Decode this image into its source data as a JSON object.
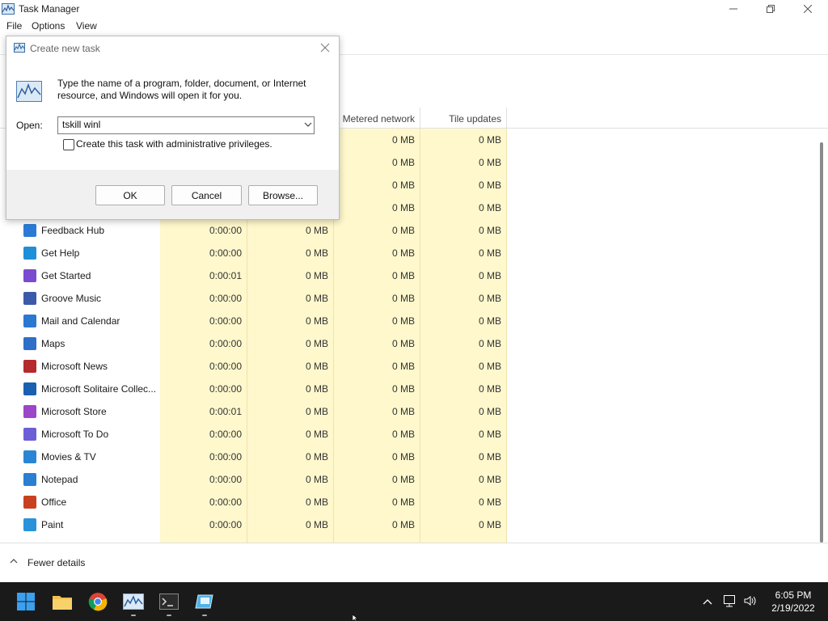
{
  "window": {
    "title": "Task Manager",
    "menu": [
      "File",
      "Options",
      "View"
    ],
    "fewer_details": "Fewer details"
  },
  "columns": {
    "metered": "Metered network",
    "tile": "Tile updates"
  },
  "rows": [
    {
      "name": "",
      "c1": "",
      "c2": "",
      "c3": "0 MB",
      "c4": "0 MB",
      "color": "#ffffff"
    },
    {
      "name": "",
      "c1": "",
      "c2": "",
      "c3": "0 MB",
      "c4": "0 MB",
      "color": "#ffffff"
    },
    {
      "name": "",
      "c1": "",
      "c2": "",
      "c3": "0 MB",
      "c4": "0 MB",
      "color": "#ffffff"
    },
    {
      "name": "",
      "c1": "",
      "c2": "",
      "c3": "0 MB",
      "c4": "0 MB",
      "color": "#ffffff"
    },
    {
      "name": "Feedback Hub",
      "c1": "0:00:00",
      "c2": "0 MB",
      "c3": "0 MB",
      "c4": "0 MB",
      "color": "#2b7bd6"
    },
    {
      "name": "Get Help",
      "c1": "0:00:00",
      "c2": "0 MB",
      "c3": "0 MB",
      "c4": "0 MB",
      "color": "#1f8fd8"
    },
    {
      "name": "Get Started",
      "c1": "0:00:01",
      "c2": "0 MB",
      "c3": "0 MB",
      "c4": "0 MB",
      "color": "#7a4bd0"
    },
    {
      "name": "Groove Music",
      "c1": "0:00:00",
      "c2": "0 MB",
      "c3": "0 MB",
      "c4": "0 MB",
      "color": "#3b5aa8"
    },
    {
      "name": "Mail and Calendar",
      "c1": "0:00:00",
      "c2": "0 MB",
      "c3": "0 MB",
      "c4": "0 MB",
      "color": "#2a78d0"
    },
    {
      "name": "Maps",
      "c1": "0:00:00",
      "c2": "0 MB",
      "c3": "0 MB",
      "c4": "0 MB",
      "color": "#2e6fc7"
    },
    {
      "name": "Microsoft News",
      "c1": "0:00:00",
      "c2": "0 MB",
      "c3": "0 MB",
      "c4": "0 MB",
      "color": "#b52a2a"
    },
    {
      "name": "Microsoft Solitaire Collec...",
      "c1": "0:00:00",
      "c2": "0 MB",
      "c3": "0 MB",
      "c4": "0 MB",
      "color": "#1b5fb0"
    },
    {
      "name": "Microsoft Store",
      "c1": "0:00:01",
      "c2": "0 MB",
      "c3": "0 MB",
      "c4": "0 MB",
      "color": "#9b45c8"
    },
    {
      "name": "Microsoft To Do",
      "c1": "0:00:00",
      "c2": "0 MB",
      "c3": "0 MB",
      "c4": "0 MB",
      "color": "#6c5fd6"
    },
    {
      "name": "Movies & TV",
      "c1": "0:00:00",
      "c2": "0 MB",
      "c3": "0 MB",
      "c4": "0 MB",
      "color": "#2a86d4"
    },
    {
      "name": "Notepad",
      "c1": "0:00:00",
      "c2": "0 MB",
      "c3": "0 MB",
      "c4": "0 MB",
      "color": "#2a7fd0"
    },
    {
      "name": "Office",
      "c1": "0:00:00",
      "c2": "0 MB",
      "c3": "0 MB",
      "c4": "0 MB",
      "color": "#c8401f"
    },
    {
      "name": "Paint",
      "c1": "0:00:00",
      "c2": "0 MB",
      "c3": "0 MB",
      "c4": "0 MB",
      "color": "#2893d8"
    }
  ],
  "dialog": {
    "title": "Create new task",
    "description": "Type the name of a program, folder, document, or Internet resource, and Windows will open it for you.",
    "open_label": "Open:",
    "input_value": "tskill winl",
    "checkbox_label": "Create this task with administrative privileges.",
    "ok": "OK",
    "cancel": "Cancel",
    "browse": "Browse..."
  },
  "taskbar": {
    "time": "6:05 PM",
    "date": "2/19/2022"
  },
  "colors": {
    "highlight_column": "#fff8cc",
    "taskbar": "#1a1a1a",
    "accent": "#0078d4"
  }
}
